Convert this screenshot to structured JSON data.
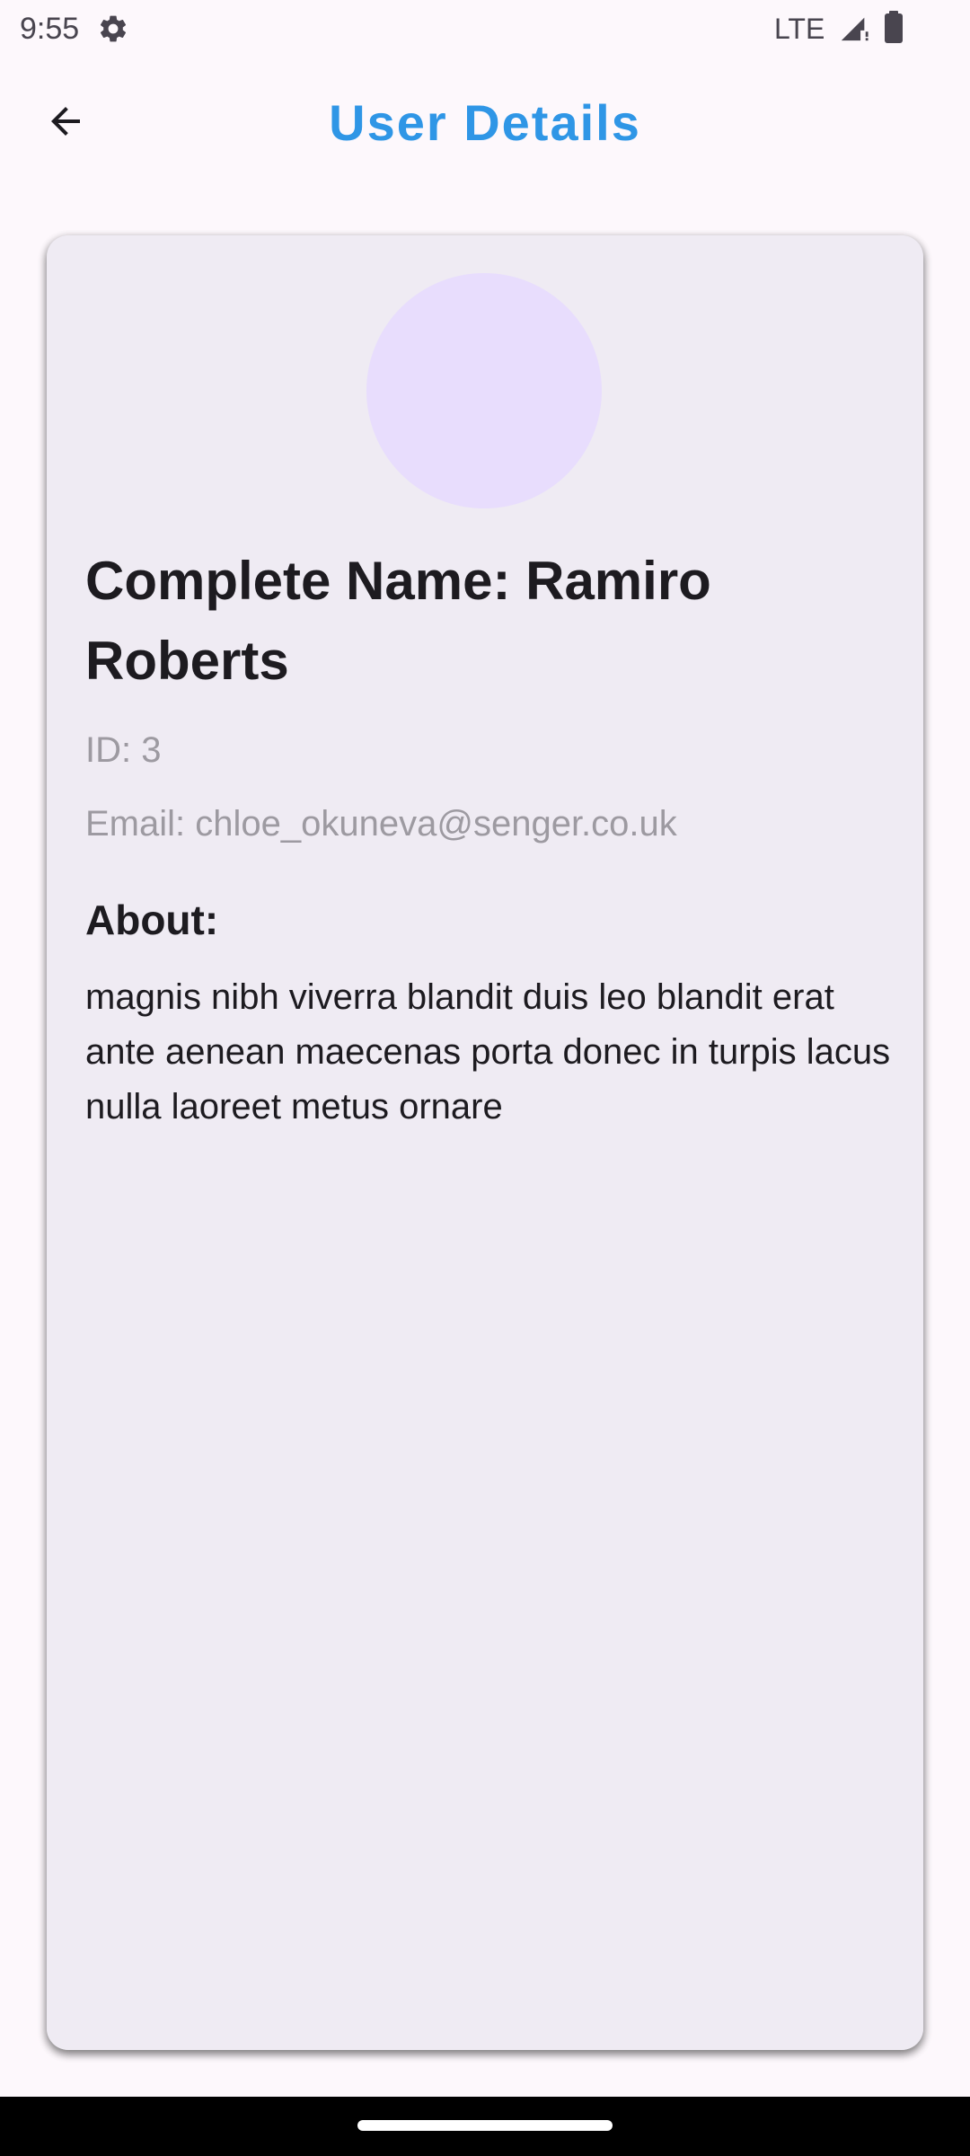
{
  "status_bar": {
    "time": "9:55",
    "network": "LTE",
    "icons": [
      "gear-icon",
      "signal-icon",
      "battery-icon"
    ]
  },
  "app_bar": {
    "title": "User Details",
    "back_icon": "arrow-back-icon",
    "title_color": "#2f96e6"
  },
  "user": {
    "complete_name": "Complete Name: Ramiro Roberts",
    "id": "ID: 3",
    "email": "Email: chloe_okuneva@senger.co.uk",
    "about_heading": "About:",
    "about_text": "magnis nibh viverra blandit duis leo blandit erat ante aenean maecenas porta donec in turpis lacus nulla laoreet metus ornare"
  },
  "colors": {
    "background": "#fdf8fc",
    "card": "#efebf3",
    "avatar": "#e8ddfd",
    "muted_text": "#9d9aa1"
  }
}
